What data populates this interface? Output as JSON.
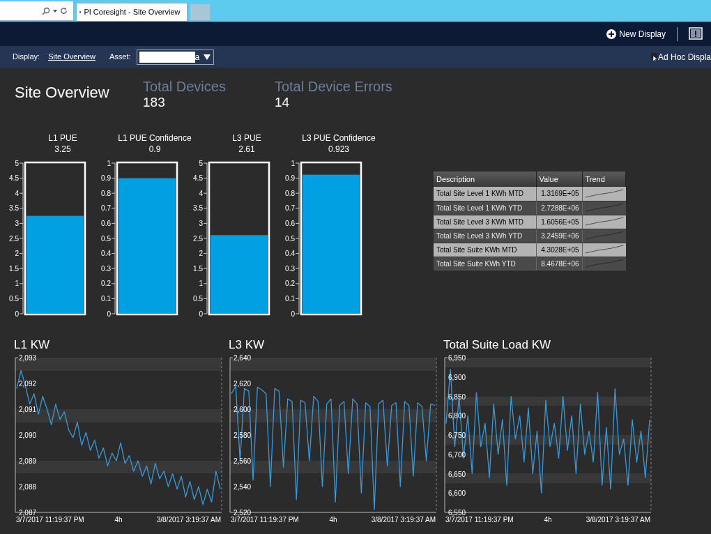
{
  "browser": {
    "tab_title": "PI Coresight - Site Overview"
  },
  "top_bar": {
    "new_display": "New Display"
  },
  "toolbar": {
    "display_label": "Display:",
    "display_link": "Site Overview",
    "asset_label": "Asset:",
    "asset_value": "a",
    "ad_hoc": "Ad Hoc Displa"
  },
  "header": {
    "title": "Site Overview",
    "stats": [
      {
        "label": "Total Devices",
        "value": "183"
      },
      {
        "label": "Total Device Errors",
        "value": "14"
      }
    ]
  },
  "gauges": [
    {
      "title": "L1 PUE",
      "value": "3.25",
      "level": 0.65,
      "ticks": [
        "5",
        "4.5",
        "4",
        "3.5",
        "3",
        "2.5",
        "2",
        "1.5",
        "1",
        "0.5",
        "0"
      ]
    },
    {
      "title": "L1 PUE Confidence",
      "value": "0.9",
      "level": 0.9,
      "ticks": [
        "1",
        "0.9",
        "0.8",
        "0.7",
        "0.6",
        "0.5",
        "0.4",
        "0.3",
        "0.2",
        "0.1",
        "0"
      ]
    },
    {
      "title": "L3 PUE",
      "value": "2.61",
      "level": 0.522,
      "ticks": [
        "5",
        "4.5",
        "4",
        "3.5",
        "3",
        "2.5",
        "2",
        "1.5",
        "1",
        "0.5",
        "0"
      ]
    },
    {
      "title": "L3 PUE Confidence",
      "value": "0.923",
      "level": 0.923,
      "ticks": [
        "1",
        "0.9",
        "0.8",
        "0.7",
        "0.6",
        "0.5",
        "0.4",
        "0.3",
        "0.2",
        "0.1",
        "0"
      ]
    }
  ],
  "table": {
    "columns": [
      "Description",
      "Value",
      "Trend"
    ],
    "rows": [
      {
        "description": "Total Site Level 1 KWh MTD",
        "value": "1.3169E+05"
      },
      {
        "description": "Total Site Level 1 KWh YTD",
        "value": "2.7288E+06"
      },
      {
        "description": "Total Site Level 3 KWh MTD",
        "value": "1.6056E+05"
      },
      {
        "description": "Total Site Level 3 KWh YTD",
        "value": "3.2459E+06"
      },
      {
        "description": "Total Site Suite KWh MTD",
        "value": "4.3028E+05"
      },
      {
        "description": "Total Site Suite KWh YTD",
        "value": "8.4678E+06"
      }
    ]
  },
  "trends": [
    {
      "title": "L1 KW",
      "start_time": "3/7/2017 11:19:37 PM",
      "duration": "4h",
      "end_time": "3/8/2017 3:19:37 AM",
      "chart_data": {
        "type": "line",
        "ylim": [
          2087,
          2093
        ],
        "yticks": [
          {
            "value": 2093,
            "label": "2,093"
          },
          {
            "value": 2092,
            "label": "2,092"
          },
          {
            "value": 2091,
            "label": "2,091"
          },
          {
            "value": 2090,
            "label": "2,090"
          },
          {
            "value": 2089,
            "label": "2,089"
          },
          {
            "value": 2088,
            "label": "2,088"
          },
          {
            "value": 2087,
            "label": "2,087"
          }
        ],
        "series": [
          {
            "color": "#3a9ad9",
            "values": [
              2091.8,
              2092.5,
              2091.9,
              2091.2,
              2091.6,
              2090.8,
              2091.5,
              2091.0,
              2090.4,
              2091.2,
              2090.6,
              2090.9,
              2090.2,
              2089.9,
              2090.5,
              2089.6,
              2090.1,
              2089.4,
              2089.8,
              2089.1,
              2089.5,
              2088.8,
              2089.3,
              2089.0,
              2089.7,
              2088.9,
              2089.2,
              2088.6,
              2089.0,
              2088.4,
              2088.8,
              2088.1,
              2088.9,
              2088.3,
              2088.6,
              2088.0,
              2088.5,
              2087.9,
              2088.4,
              2087.6,
              2088.2,
              2087.5,
              2088.0,
              2087.3,
              2087.9,
              2087.4,
              2088.6,
              2087.9
            ]
          }
        ]
      }
    },
    {
      "title": "L3 KW",
      "start_time": "3/7/2017 11:19:37 PM",
      "duration": "4h",
      "end_time": "3/8/2017 3:19:37 AM",
      "chart_data": {
        "type": "line",
        "ylim": [
          2520,
          2640
        ],
        "yticks": [
          {
            "value": 2640,
            "label": "2,640"
          },
          {
            "value": 2620,
            "label": "2,620"
          },
          {
            "value": 2600,
            "label": "2,600"
          },
          {
            "value": 2580,
            "label": "2,580"
          },
          {
            "value": 2560,
            "label": "2,560"
          },
          {
            "value": 2540,
            "label": "2,540"
          },
          {
            "value": 2520,
            "label": "2,520"
          }
        ],
        "series": [
          {
            "color": "#3a9ad9",
            "values": [
              2612,
              2618,
              2560,
              2616,
              2614,
              2545,
              2617,
              2615,
              2612,
              2540,
              2616,
              2614,
              2555,
              2608,
              2606,
              2530,
              2607,
              2605,
              2560,
              2610,
              2606,
              2540,
              2604,
              2608,
              2528,
              2603,
              2606,
              2550,
              2608,
              2604,
              2535,
              2605,
              2602,
              2522,
              2604,
              2607,
              2556,
              2603,
              2605,
              2540,
              2606,
              2603,
              2548,
              2605,
              2602,
              2560,
              2604,
              2603
            ]
          }
        ]
      }
    },
    {
      "title": "Total Suite Load KW",
      "start_time": "3/7/2017 11:19:37 PM",
      "duration": "4h",
      "end_time": "3/8/2017 3:19:37 AM",
      "chart_data": {
        "type": "line",
        "ylim": [
          6550,
          6950
        ],
        "yticks": [
          {
            "value": 6950,
            "label": "6,950"
          },
          {
            "value": 6900,
            "label": "6,900"
          },
          {
            "value": 6850,
            "label": "6,850"
          },
          {
            "value": 6800,
            "label": "6,800"
          },
          {
            "value": 6750,
            "label": "6,750"
          },
          {
            "value": 6700,
            "label": "6,700"
          },
          {
            "value": 6650,
            "label": "6,650"
          },
          {
            "value": 6600,
            "label": "6,600"
          },
          {
            "value": 6550,
            "label": "6,550"
          }
        ],
        "series": [
          {
            "color": "#3a9ad9",
            "values": [
              6780,
              6920,
              6720,
              6850,
              6690,
              6800,
              6650,
              6860,
              6720,
              6780,
              6640,
              6830,
              6700,
              6790,
              6620,
              6850,
              6740,
              6800,
              6680,
              6820,
              6650,
              6760,
              6600,
              6840,
              6720,
              6780,
              6690,
              6850,
              6710,
              6800,
              6650,
              6830,
              6700,
              6760,
              6680,
              6860,
              6620,
              6770,
              6610,
              6870,
              6700,
              6740,
              6620,
              6790,
              6680,
              6760,
              6640,
              6790
            ]
          }
        ]
      }
    }
  ]
}
